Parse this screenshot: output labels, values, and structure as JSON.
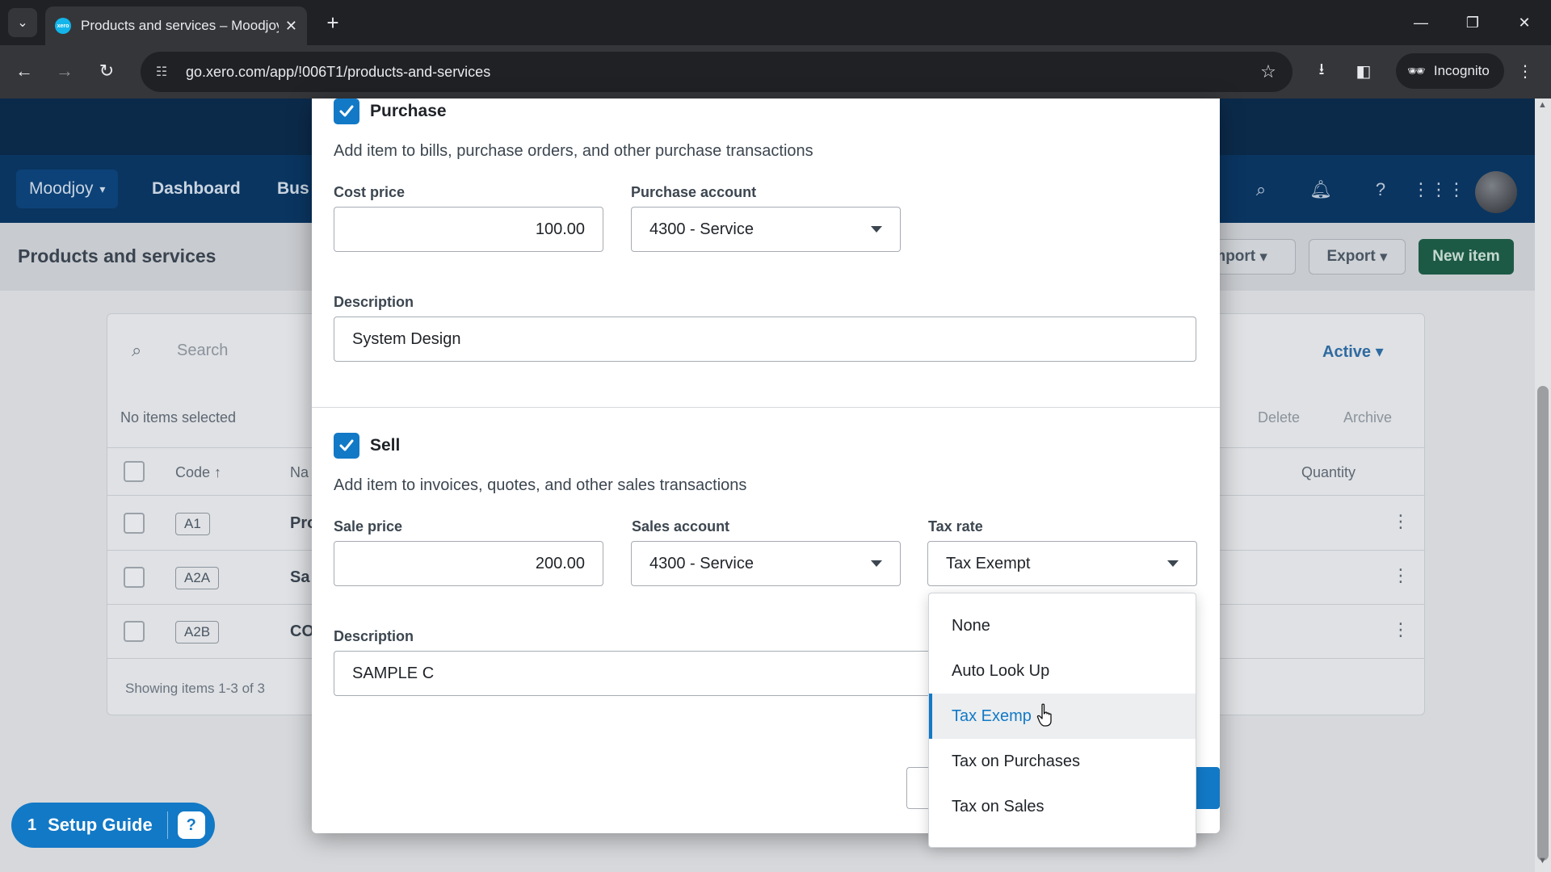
{
  "browser": {
    "tab_title": "Products and services – Moodjoy",
    "tab_favicon_text": "xero",
    "url": "go.xero.com/app/!006T1/products-and-services",
    "incognito_label": "Incognito"
  },
  "app": {
    "org_name": "Moodjoy",
    "nav": [
      "Dashboard",
      "Bus"
    ],
    "page_title": "Products and services",
    "header_buttons": {
      "import": "Import",
      "export": "Export",
      "new_item": "New item"
    },
    "search_placeholder": "Search",
    "filter_label": "Active",
    "no_items_selected": "No items selected",
    "bulk_actions": {
      "delete": "Delete",
      "archive": "Archive"
    },
    "columns": {
      "code": "Code",
      "name": "Na",
      "quantity": "Quantity"
    },
    "rows": [
      {
        "code": "A1",
        "name": "Pro"
      },
      {
        "code": "A2A",
        "name": "Sa"
      },
      {
        "code": "A2B",
        "name": "CO"
      }
    ],
    "showing": "Showing items 1-3 of 3",
    "setup_guide": {
      "count": "1",
      "label": "Setup Guide"
    }
  },
  "modal": {
    "purchase": {
      "label": "Purchase",
      "checked": true,
      "description": "Add item to bills, purchase orders, and other purchase transactions",
      "cost_price_label": "Cost price",
      "cost_price": "100.00",
      "account_label": "Purchase account",
      "account": "4300 - Service",
      "desc_label": "Description",
      "desc_value": "System Design"
    },
    "sell": {
      "label": "Sell",
      "checked": true,
      "description": "Add item to invoices, quotes, and other sales transactions",
      "sale_price_label": "Sale price",
      "sale_price": "200.00",
      "account_label": "Sales account",
      "account": "4300 - Service",
      "tax_rate_label": "Tax rate",
      "tax_rate": "Tax Exempt",
      "desc_label": "Description",
      "desc_value": "SAMPLE C"
    }
  },
  "tax_dropdown": {
    "options": [
      "None",
      "Auto Look Up",
      "Tax Exempt",
      "Tax on Purchases",
      "Tax on Sales"
    ],
    "selected": "Tax Exempt",
    "selected_display": "Tax Exemp"
  },
  "colors": {
    "accent": "#1279c6",
    "xero_nav": "#0a3561",
    "primary_button": "#1d5a46"
  }
}
